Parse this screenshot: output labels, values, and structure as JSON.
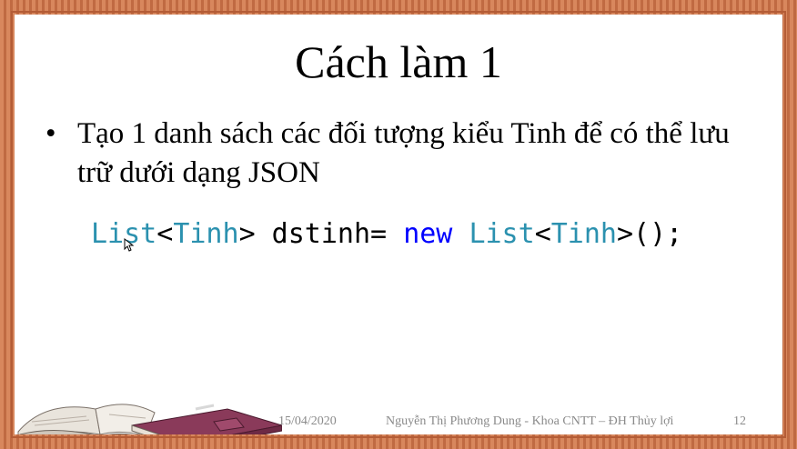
{
  "slide": {
    "title": "Cách làm 1",
    "bullet_marker": "•",
    "bullet_text": "Tạo 1 danh sách các đối tượng kiểu Tinh để có thể lưu trữ dưới dạng JSON",
    "code": {
      "tokens": [
        {
          "text": "List",
          "kind": "type"
        },
        {
          "text": "<",
          "kind": "plain"
        },
        {
          "text": "Tinh",
          "kind": "type"
        },
        {
          "text": "> dstinh= ",
          "kind": "plain"
        },
        {
          "text": "new",
          "kind": "keyword"
        },
        {
          "text": " ",
          "kind": "plain"
        },
        {
          "text": "List",
          "kind": "type"
        },
        {
          "text": "<",
          "kind": "plain"
        },
        {
          "text": "Tinh",
          "kind": "type"
        },
        {
          "text": ">();",
          "kind": "plain"
        }
      ]
    }
  },
  "footer": {
    "date": "15/04/2020",
    "author": "Nguyễn Thị Phương Dung - Khoa CNTT – ĐH Thủy lợi",
    "page_number": "12"
  },
  "colors": {
    "frame": "#cf7b52",
    "type_color": "#2b91af",
    "keyword_color": "#0000ff",
    "footer_text": "#8a8a8a"
  },
  "icons": {
    "decoration": "open-books-illustration",
    "cursor": "mouse-pointer-icon"
  }
}
